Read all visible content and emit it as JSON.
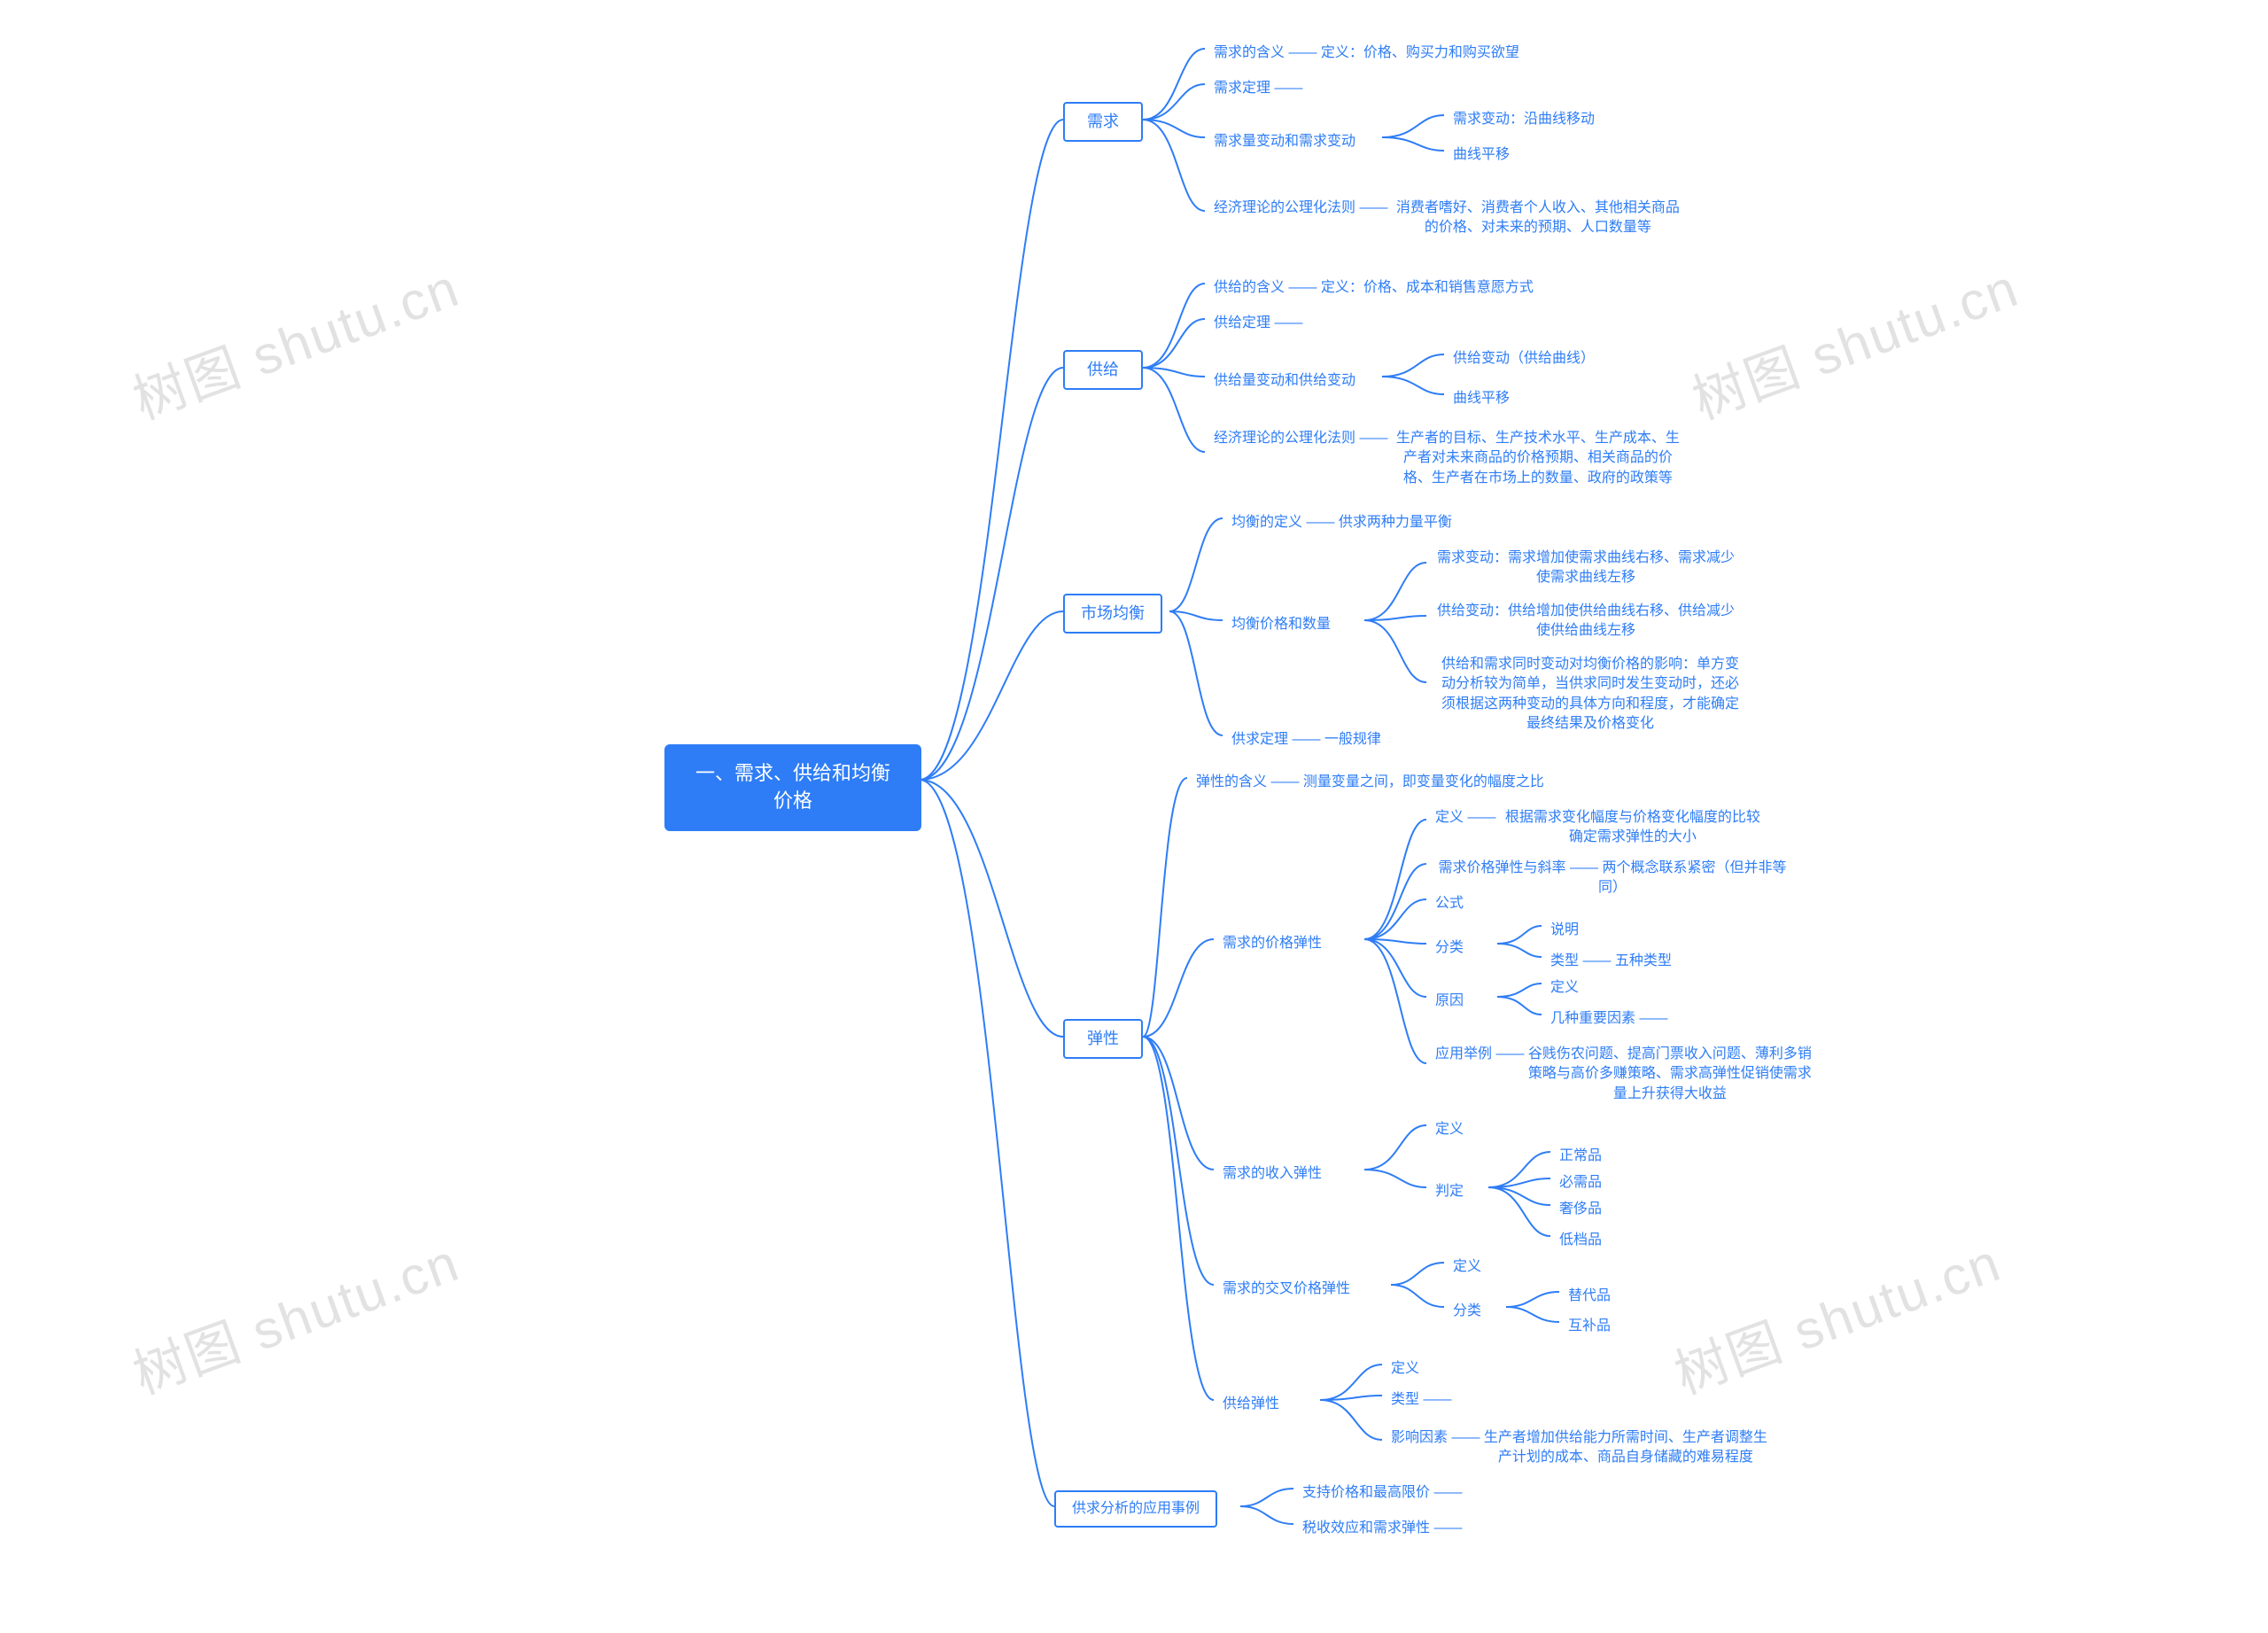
{
  "watermark": "树图 shutu.cn",
  "root": "一、需求、供给和均衡价格",
  "branches": {
    "b1": "需求",
    "b2": "供给",
    "b3": "市场均衡",
    "b4": "弹性",
    "b5": "供求分析的应用事例"
  },
  "b1": {
    "n1": "需求的含义",
    "n1d": "定义：价格、购买力和购买欲望",
    "n2": "需求定理 ——",
    "n3": "需求量变动和需求变动",
    "n3a": "需求变动：沿曲线移动",
    "n3b": "曲线平移",
    "n4": "经济理论的公理化法则 ——",
    "n4d": "消费者嗜好、消费者个人收入、其他相关商品的价格、对未来的预期、人口数量等"
  },
  "b2": {
    "n1": "供给的含义 —— 定义：价格、成本和销售意愿方式",
    "n2": "供给定理 ——",
    "n3": "供给量变动和供给变动",
    "n3a": "供给变动（供给曲线）",
    "n3b": "曲线平移",
    "n4": "经济理论的公理化法则 ——",
    "n4d": "生产者的目标、生产技术水平、生产成本、生产者对未来商品的价格预期、相关商品的价格、生产者在市场上的数量、政府的政策等"
  },
  "b3": {
    "n1": "均衡的定义 —— 供求两种力量平衡",
    "n2": "均衡价格和数量",
    "n2a": "需求变动：需求增加使需求曲线右移、需求减少使需求曲线左移",
    "n2b": "供给变动：供给增加使供给曲线右移、供给减少使供给曲线左移",
    "n2c": "供给和需求同时变动对均衡价格的影响：单方变动分析较为简单，当供求同时发生变动时，还必须根据这两种变动的具体方向和程度，才能确定最终结果及价格变化",
    "n3": "供求定理 —— 一般规律"
  },
  "b4": {
    "n0": "弹性的含义 —— 测量变量之间，即变量变化的幅度之比",
    "n1": "需求的价格弹性",
    "n1a": "定义 ——",
    "n1ad": "根据需求变化幅度与价格变化幅度的比较确定需求弹性的大小",
    "n1b": "需求价格弹性与斜率 —— 两个概念联系紧密（但并非等同）",
    "n1c": "公式",
    "n1d": "分类",
    "n1da": "说明",
    "n1db": "类型 —— 五种类型",
    "n1e": "原因",
    "n1ea": "定义",
    "n1eb": "几种重要因素 ——",
    "n1f": "应用举例 ——",
    "n1fd": "谷贱伤农问题、提高门票收入问题、薄利多销策略与高价多赚策略、需求高弹性促销使需求量上升获得大收益",
    "n2": "需求的收入弹性",
    "n2a": "定义",
    "n2b": "判定",
    "n2ba": "正常品",
    "n2bb": "必需品",
    "n2bc": "奢侈品",
    "n2bd": "低档品",
    "n3": "需求的交叉价格弹性",
    "n3a": "定义",
    "n3b": "分类",
    "n3ba": "替代品",
    "n3bb": "互补品",
    "n4": "供给弹性",
    "n4a": "定义",
    "n4b": "类型 ——",
    "n4c": "影响因素 ——",
    "n4cd": "生产者增加供给能力所需时间、生产者调整生产计划的成本、商品自身储藏的难易程度"
  },
  "b5": {
    "n1": "支持价格和最高限价 ——",
    "n2": "税收效应和需求弹性 ——"
  }
}
